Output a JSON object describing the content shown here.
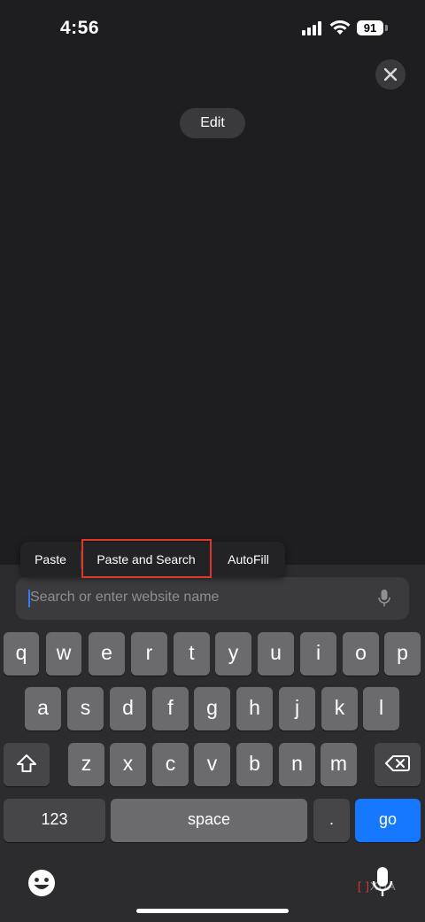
{
  "status_bar": {
    "time": "4:56",
    "battery": "91"
  },
  "top": {
    "edit_label": "Edit"
  },
  "context_menu": {
    "paste": "Paste",
    "paste_and_search": "Paste and Search",
    "autofill": "AutoFill"
  },
  "search": {
    "placeholder": "Search or enter website name"
  },
  "keyboard": {
    "row1": [
      "q",
      "w",
      "e",
      "r",
      "t",
      "y",
      "u",
      "i",
      "o",
      "p"
    ],
    "row2": [
      "a",
      "s",
      "d",
      "f",
      "g",
      "h",
      "j",
      "k",
      "l"
    ],
    "row3": [
      "z",
      "x",
      "c",
      "v",
      "b",
      "n",
      "m"
    ],
    "numbers": "123",
    "space": "space",
    "period": ".",
    "go": "go"
  },
  "watermark": "XDA",
  "colors": {
    "accent": "#1677ff",
    "highlight": "#e0372b",
    "caret": "#2f7cf6"
  }
}
